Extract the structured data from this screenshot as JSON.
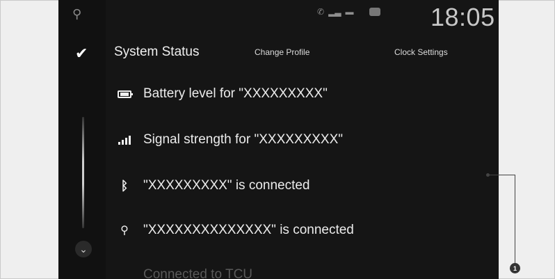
{
  "status_bar": {
    "usb_icon": "usb-icon",
    "clock": "18:05"
  },
  "header": {
    "title": "System Status",
    "tabs": [
      {
        "label": "Change Profile"
      },
      {
        "label": "Clock Settings"
      }
    ]
  },
  "list": {
    "items": [
      {
        "icon": "battery-icon",
        "label": "Battery level for \"XXXXXXXXX\""
      },
      {
        "icon": "signal-icon",
        "label": "Signal strength for \"XXXXXXXXX\""
      },
      {
        "icon": "bluetooth-icon",
        "label": "\"XXXXXXXXX\" is connected"
      },
      {
        "icon": "usb-icon",
        "label": "\"XXXXXXXXXXXXXX\" is connected"
      },
      {
        "icon": "",
        "label": "Connected to TCU"
      }
    ]
  },
  "callout": {
    "number": "1"
  }
}
